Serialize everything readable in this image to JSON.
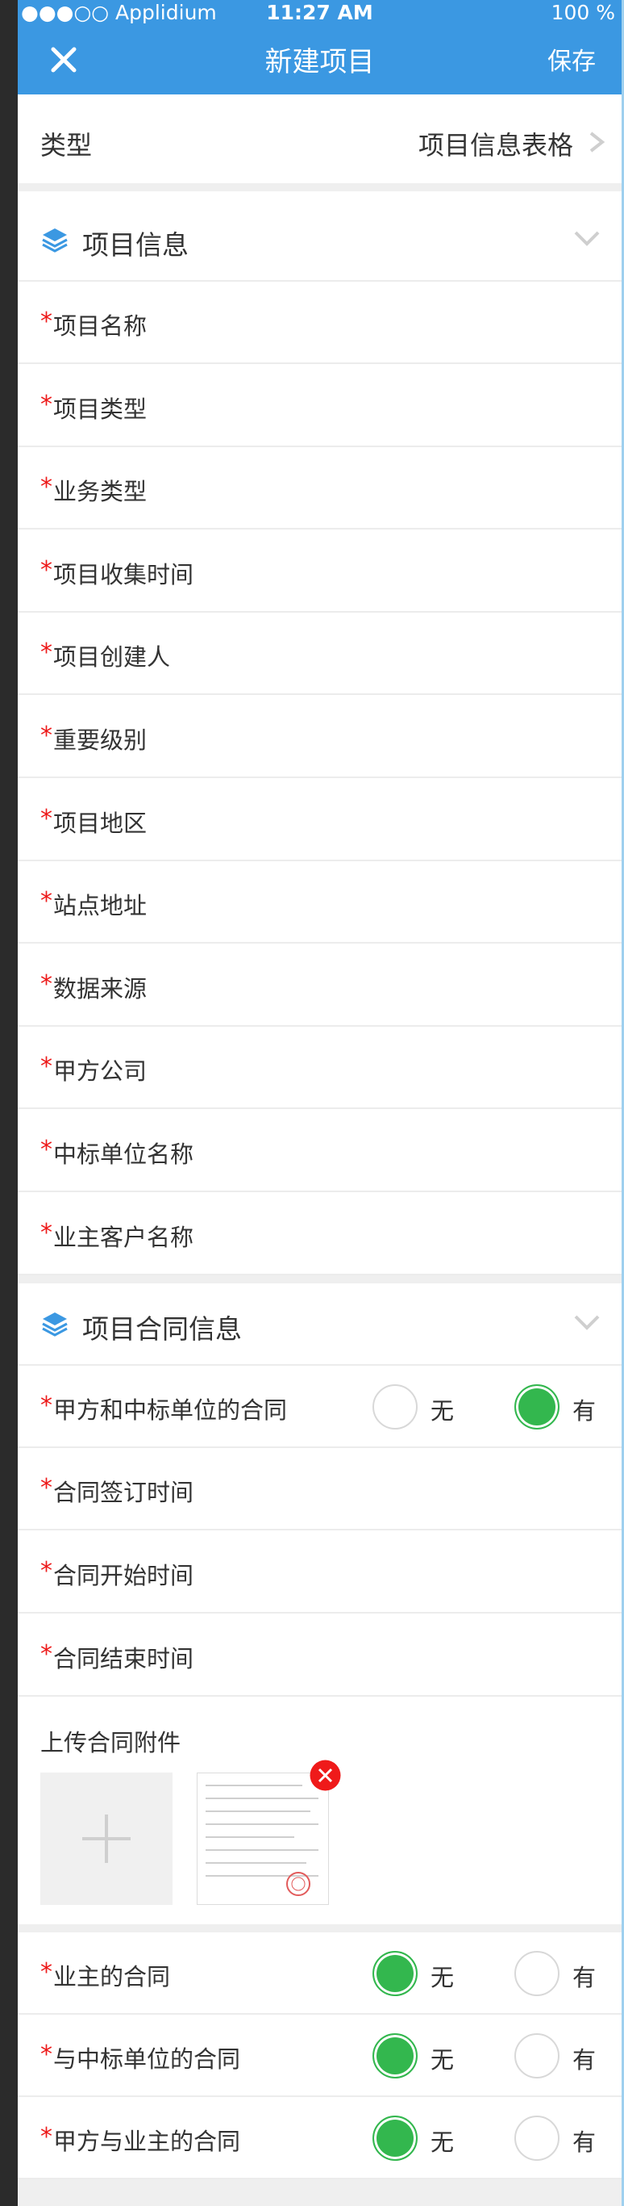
{
  "status_bar": {
    "carrier": "●●●○○ Applidium",
    "time": "11:27 AM",
    "battery": "100 %"
  },
  "nav": {
    "title": "新建项目",
    "save_label": "保存"
  },
  "type_row": {
    "label": "类型",
    "value": "项目信息表格"
  },
  "section_project": {
    "title": "项目信息"
  },
  "required_mark": "*",
  "project_fields": [
    "项目名称",
    "项目类型",
    "业务类型",
    "项目收集时间",
    "项目创建人",
    "重要级别",
    "项目地区",
    "站点地址",
    "数据来源",
    "甲方公司",
    "中标单位名称",
    "业主客户名称"
  ],
  "section_contract": {
    "title": "项目合同信息"
  },
  "contract_radio_rows": [
    {
      "label": "甲方和中标单位的合同",
      "opt_no": "无",
      "opt_yes": "有",
      "selected": "有"
    }
  ],
  "contract_fields": [
    "合同签订时间",
    "合同开始时间",
    "合同结束时间"
  ],
  "upload": {
    "title": "上传合同附件"
  },
  "bottom_radio_rows": [
    {
      "label": "业主的合同",
      "opt_no": "无",
      "opt_yes": "有",
      "selected": "无"
    },
    {
      "label": "与中标单位的合同",
      "opt_no": "无",
      "opt_yes": "有",
      "selected": "无"
    },
    {
      "label": "甲方与业主的合同",
      "opt_no": "无",
      "opt_yes": "有",
      "selected": "无"
    }
  ],
  "colors": {
    "accent": "#3b98e2",
    "radio_on": "#33b74e",
    "required": "#ed1919",
    "delete": "#ef1a1a",
    "text": "#333333"
  },
  "icons": {
    "close": "close-icon",
    "layers": "layers-icon",
    "chevron": "chevron-down-icon",
    "delete": "delete-icon",
    "plus": "plus-icon"
  }
}
